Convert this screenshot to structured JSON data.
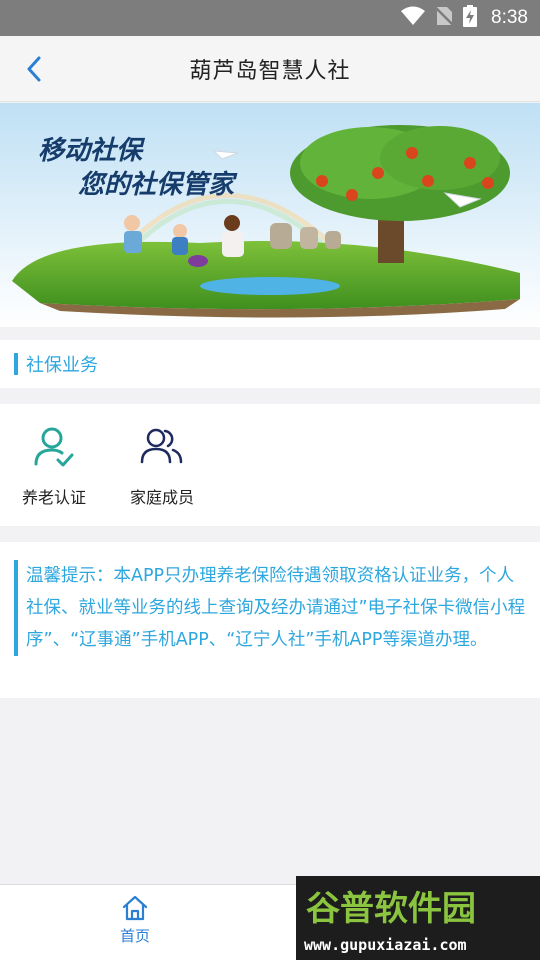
{
  "status_bar": {
    "time": "8:38"
  },
  "header": {
    "title": "葫芦岛智慧人社",
    "back_icon": "chevron-left-icon"
  },
  "banner": {
    "line1": "移动社保",
    "line2": "您的社保管家"
  },
  "section": {
    "label": "社保业务"
  },
  "services": [
    {
      "label": "养老认证",
      "icon": "user-check-icon"
    },
    {
      "label": "家庭成员",
      "icon": "users-icon"
    }
  ],
  "notice": {
    "text": "温馨提示：本APP只办理养老保险待遇领取资格认证业务，个人社保、就业等业务的线上查询及经办请通过”电子社保卡微信小程序”、“辽事通”手机APP、“辽宁人社”手机APP等渠道办理。"
  },
  "bottom_nav": {
    "home_label": "首页"
  },
  "watermark": {
    "brand": "谷普软件园",
    "url": "www.gupuxiazai.com"
  },
  "colors": {
    "accent": "#2ea7df",
    "teal_icon": "#26a69a",
    "nav_active": "#2b7fd4"
  }
}
